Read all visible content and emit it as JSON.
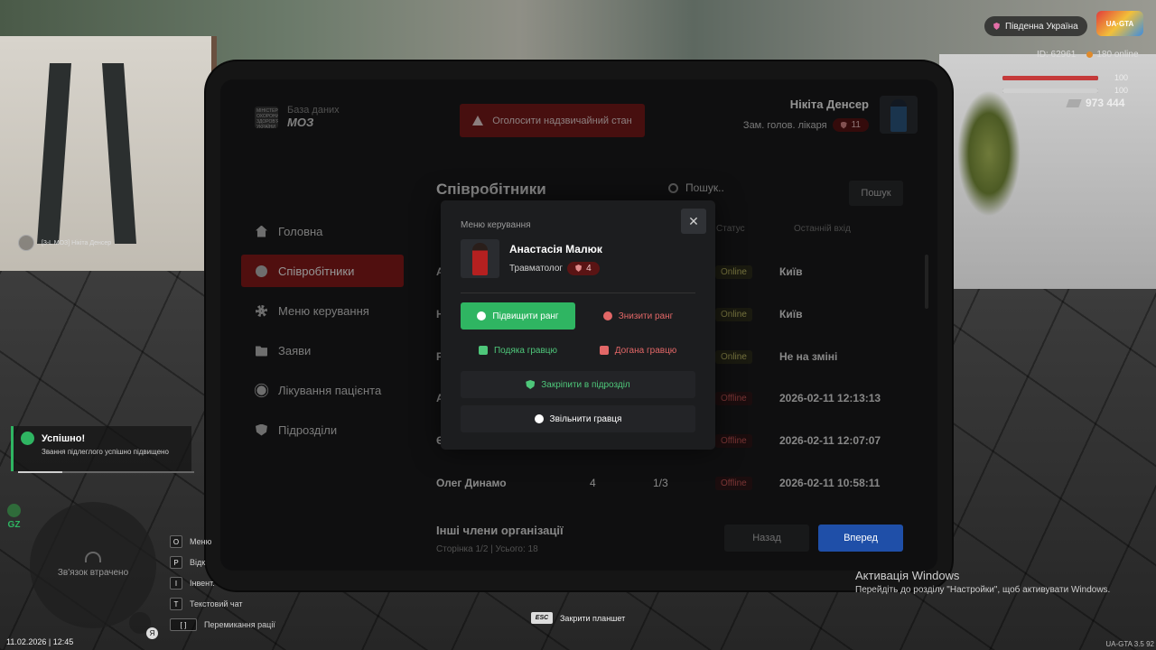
{
  "hud": {
    "server_name": "Південна Україна",
    "game_logo": "UA·GTA",
    "player_id": "ID: 62961",
    "online": "180 online",
    "health": 100,
    "armor": 100,
    "health_label": "100",
    "armor_label": "100",
    "money": "973 444",
    "player_tag": "[3-L МОЗ] Нікіта Денсер",
    "notification": {
      "title": "Успішно!",
      "text": "Звання підлеглого успішно підвищено",
      "progress": 0.25
    },
    "gz_label": "GZ",
    "radar_text": "Зв'язок втрачено",
    "keys": [
      {
        "key": "O",
        "label": "Меню"
      },
      {
        "key": "P",
        "label": "Відк"
      },
      {
        "key": "I",
        "label": "Інвент."
      },
      {
        "key": "T",
        "label": "Текстовий чат"
      },
      {
        "key": "[ ]",
        "label": "Перемикання рації"
      }
    ],
    "mic_badge": "Я",
    "datetime": "11.02.2026 | 12:45",
    "esc_key": "ESC",
    "esc_label": "Закрити планшет",
    "windows_activation_title": "Активація Windows",
    "windows_activation_text": "Перейдіть до розділу \"Настройки\", щоб активувати Windows.",
    "version": "UA-GTA 3.5  92"
  },
  "tablet": {
    "logo_emblem": "МІНІСТЕРСТВО ОХОРОНИ ЗДОРОВ'Я УКРАЇНИ",
    "logo_line1": "База даних",
    "logo_line2": "МОЗ",
    "emergency_label": "Оголосити надзвичайний стан",
    "user": {
      "name": "Нікіта Денсер",
      "role": "Зам. голов. лікаря",
      "rank": "11"
    },
    "nav": [
      {
        "label": "Головна",
        "icon": "home-icon",
        "active": false
      },
      {
        "label": "Співробітники",
        "icon": "users-icon",
        "active": true
      },
      {
        "label": "Меню керування",
        "icon": "gear-icon",
        "active": false
      },
      {
        "label": "Заяви",
        "icon": "folder-icon",
        "active": false
      },
      {
        "label": "Лікування пацієнта",
        "icon": "virus-icon",
        "active": false
      },
      {
        "label": "Підрозділи",
        "icon": "shield-icon",
        "active": false
      }
    ],
    "title": "Співробітники",
    "search_placeholder": "Пошук..",
    "search_button": "Пошук",
    "columns": {
      "status": "Статус",
      "last_login": "Останній вхід"
    },
    "rows": [
      {
        "name": "А",
        "rank": "",
        "div": "",
        "status": "Online",
        "last": "Київ"
      },
      {
        "name": "Н",
        "rank": "",
        "div": "",
        "status": "Online",
        "last": "Київ"
      },
      {
        "name": "Р",
        "rank": "",
        "div": "",
        "status": "Online",
        "last": "Не на зміні"
      },
      {
        "name": "А",
        "rank": "",
        "div": "",
        "status": "Offline",
        "last": "2026-02-11 12:13:13"
      },
      {
        "name": "Є",
        "rank": "",
        "div": "",
        "status": "Offline",
        "last": "2026-02-11 12:07:07"
      },
      {
        "name": "Олег Динамо",
        "rank": "4",
        "div": "1/3",
        "status": "Offline",
        "last": "2026-02-11 10:58:11"
      }
    ],
    "others_title": "Інші члени організації",
    "pagination": "Сторінка 1/2 | Усього: 18",
    "back_button": "Назад",
    "next_button": "Вперед"
  },
  "modal": {
    "title": "Меню керування",
    "close": "✕",
    "employee": {
      "name": "Анастасія Малюк",
      "role": "Травматолог",
      "rank": "4"
    },
    "actions": {
      "promote": "Підвищити ранг",
      "demote": "Знизити ранг",
      "thanks": "Подяка гравцю",
      "rebuke": "Догана гравцю",
      "assign": "Закріпити в підрозділ",
      "fire": "Звільнити гравця"
    }
  },
  "colors": {
    "accent_red": "#8a1a1a",
    "success_green": "#2fb562",
    "next_blue": "#1f4fa8"
  }
}
